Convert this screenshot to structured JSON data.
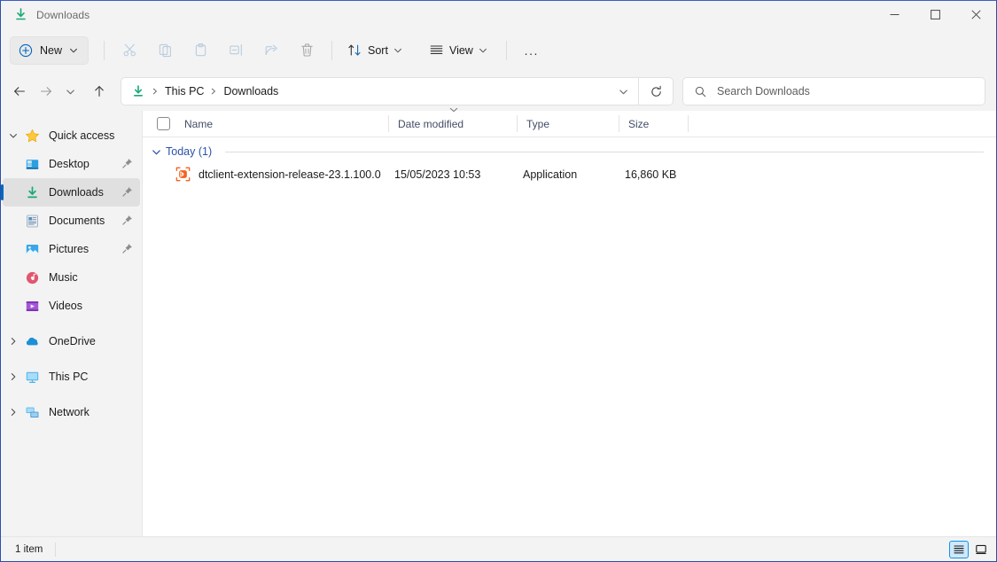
{
  "window": {
    "title": "Downloads",
    "title_icon": "downloads-arrow-icon",
    "controls": {
      "minimize": "Minimize",
      "maximize": "Maximize",
      "close": "Close"
    }
  },
  "toolbar": {
    "new_label": "New",
    "new_icon": "plus-circle-icon",
    "items": [
      {
        "name": "cut",
        "icon": "scissors-icon",
        "disabled": true
      },
      {
        "name": "copy",
        "icon": "copy-icon",
        "disabled": true
      },
      {
        "name": "paste",
        "icon": "clipboard-icon",
        "disabled": true
      },
      {
        "name": "rename",
        "icon": "rename-icon",
        "disabled": true
      },
      {
        "name": "share",
        "icon": "share-icon",
        "disabled": true
      },
      {
        "name": "delete",
        "icon": "trash-icon",
        "disabled": true
      }
    ],
    "sort_label": "Sort",
    "view_label": "View",
    "overflow_label": "..."
  },
  "address": {
    "back": "Back",
    "forward": "Forward",
    "recent": "Recent locations",
    "up": "Up",
    "crumb_icon": "downloads-arrow-icon",
    "crumbs": [
      "This PC",
      "Downloads"
    ],
    "refresh": "Refresh",
    "dropdown": "Previous locations"
  },
  "search": {
    "placeholder": "Search Downloads",
    "icon": "search-icon"
  },
  "sidebar": {
    "groups": [
      {
        "name": "Quick access",
        "icon": "star-icon",
        "expanded": true,
        "children": [
          {
            "label": "Desktop",
            "icon": "desktop-icon",
            "pinned": true,
            "selected": false
          },
          {
            "label": "Downloads",
            "icon": "downloads-icon",
            "pinned": true,
            "selected": true
          },
          {
            "label": "Documents",
            "icon": "documents-icon",
            "pinned": true,
            "selected": false
          },
          {
            "label": "Pictures",
            "icon": "pictures-icon",
            "pinned": true,
            "selected": false
          },
          {
            "label": "Music",
            "icon": "music-icon",
            "pinned": false,
            "selected": false
          },
          {
            "label": "Videos",
            "icon": "videos-icon",
            "pinned": false,
            "selected": false
          }
        ]
      },
      {
        "name": "OneDrive",
        "icon": "cloud-icon",
        "expanded": false,
        "children": []
      },
      {
        "name": "This PC",
        "icon": "monitor-icon",
        "expanded": false,
        "children": []
      },
      {
        "name": "Network",
        "icon": "network-icon",
        "expanded": false,
        "children": []
      }
    ]
  },
  "filelist": {
    "columns": [
      {
        "key": "name",
        "label": "Name",
        "sorted": false
      },
      {
        "key": "date",
        "label": "Date modified",
        "sorted": true,
        "direction": "descending"
      },
      {
        "key": "type",
        "label": "Type",
        "sorted": false
      },
      {
        "key": "size",
        "label": "Size",
        "sorted": false
      }
    ],
    "groups": [
      {
        "label": "Today (1)",
        "expanded": true,
        "rows": [
          {
            "name": "dtclient-extension-release-23.1.100.0",
            "date": "15/05/2023 10:53",
            "type": "Application",
            "size": "16,860 KB",
            "icon": "application-exe-icon"
          }
        ]
      }
    ]
  },
  "status": {
    "item_count": "1 item",
    "views": [
      {
        "name": "details-view",
        "icon": "details-lines-icon",
        "active": true
      },
      {
        "name": "large-icons-view",
        "icon": "large-icon-tile-icon",
        "active": false
      }
    ]
  },
  "colors": {
    "accent": "#0067c0",
    "group_header": "#2b52a8",
    "chrome": "#f3f3f3",
    "surface": "#ffffff",
    "download_green": "#1a9e67",
    "app_icon_orange": "#f4621f"
  }
}
